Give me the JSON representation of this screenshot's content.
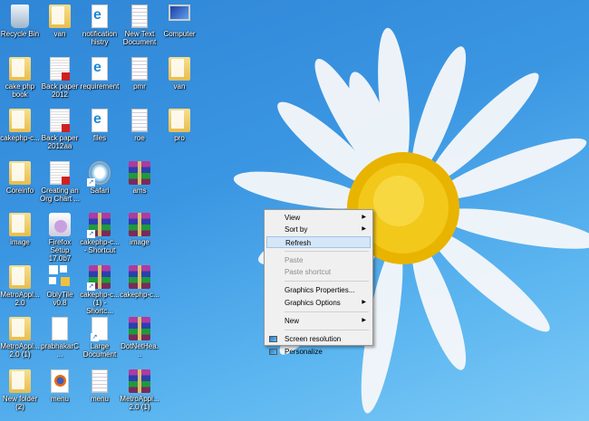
{
  "desktop": {
    "icons": [
      {
        "label": "Recycle Bin",
        "type": "recycle",
        "col": 0,
        "row": 0
      },
      {
        "label": "van",
        "type": "folder",
        "col": 1,
        "row": 0
      },
      {
        "label": "notification histry",
        "type": "ie",
        "col": 2,
        "row": 0
      },
      {
        "label": "New Text Document",
        "type": "doc",
        "col": 3,
        "row": 0
      },
      {
        "label": "Computer",
        "type": "computer",
        "col": 4,
        "row": 0
      },
      {
        "label": "cake php book",
        "type": "folder",
        "col": 0,
        "row": 1
      },
      {
        "label": "Back paper 2012",
        "type": "pdf",
        "col": 1,
        "row": 1
      },
      {
        "label": "requirement",
        "type": "ie",
        "col": 2,
        "row": 1
      },
      {
        "label": "pmr",
        "type": "doc",
        "col": 3,
        "row": 1
      },
      {
        "label": "van",
        "type": "folder",
        "col": 4,
        "row": 1
      },
      {
        "label": "cakephp-c...",
        "type": "folder",
        "col": 0,
        "row": 2
      },
      {
        "label": "Back paper 2012aa",
        "type": "pdf",
        "col": 1,
        "row": 2
      },
      {
        "label": "files",
        "type": "ie",
        "col": 2,
        "row": 2
      },
      {
        "label": "roe",
        "type": "doc",
        "col": 3,
        "row": 2
      },
      {
        "label": "pro",
        "type": "folder",
        "col": 4,
        "row": 2
      },
      {
        "label": "Coreinfo",
        "type": "folder",
        "col": 0,
        "row": 3
      },
      {
        "label": "Creating an Org Chart ...",
        "type": "pdf",
        "col": 1,
        "row": 3
      },
      {
        "label": "Safari",
        "type": "safari",
        "col": 2,
        "row": 3,
        "shortcut": true
      },
      {
        "label": "ams",
        "type": "rar",
        "col": 3,
        "row": 3
      },
      {
        "label": "image",
        "type": "folder",
        "col": 0,
        "row": 4
      },
      {
        "label": "Firefox Setup 17.0b7",
        "type": "setup",
        "col": 1,
        "row": 4
      },
      {
        "label": "cakephp-c... - Shortcut",
        "type": "rar",
        "col": 2,
        "row": 4,
        "shortcut": true
      },
      {
        "label": "image",
        "type": "rar",
        "col": 3,
        "row": 4
      },
      {
        "label": "MetroAppl... 2.0",
        "type": "folder",
        "col": 0,
        "row": 5
      },
      {
        "label": "OblyTile v0.8",
        "type": "obly",
        "col": 1,
        "row": 5
      },
      {
        "label": "cakephp-c... (1) - Shortc...",
        "type": "rar",
        "col": 2,
        "row": 5,
        "shortcut": true
      },
      {
        "label": "cakephp-c...",
        "type": "rar",
        "col": 3,
        "row": 5
      },
      {
        "label": "MetroAppl... 2.0 (1)",
        "type": "folder",
        "col": 0,
        "row": 6
      },
      {
        "label": "prabhakarC...",
        "type": "blank",
        "col": 1,
        "row": 6
      },
      {
        "label": "Large Document",
        "type": "blank",
        "col": 2,
        "row": 6,
        "shortcut": true
      },
      {
        "label": "DotNetHea...",
        "type": "rar",
        "col": 3,
        "row": 6
      },
      {
        "label": "New folder (2)",
        "type": "folder",
        "col": 0,
        "row": 7
      },
      {
        "label": "menu",
        "type": "firefox",
        "col": 1,
        "row": 7
      },
      {
        "label": "menu",
        "type": "doc",
        "col": 2,
        "row": 7
      },
      {
        "label": "MetroAppl... 2.0 (1)",
        "type": "rar",
        "col": 3,
        "row": 7
      }
    ]
  },
  "context_menu": {
    "items": [
      {
        "label": "View",
        "submenu": true
      },
      {
        "label": "Sort by",
        "submenu": true
      },
      {
        "label": "Refresh",
        "highlighted": true
      },
      {
        "sep": true
      },
      {
        "label": "Paste",
        "disabled": true
      },
      {
        "label": "Paste shortcut",
        "disabled": true
      },
      {
        "sep": true
      },
      {
        "label": "Graphics Properties..."
      },
      {
        "label": "Graphics Options",
        "submenu": true
      },
      {
        "sep": true
      },
      {
        "label": "New",
        "submenu": true
      },
      {
        "sep": true
      },
      {
        "label": "Screen resolution",
        "icon": "screen-resolution-icon"
      },
      {
        "label": "Personalize",
        "icon": "personalize-icon"
      }
    ]
  }
}
